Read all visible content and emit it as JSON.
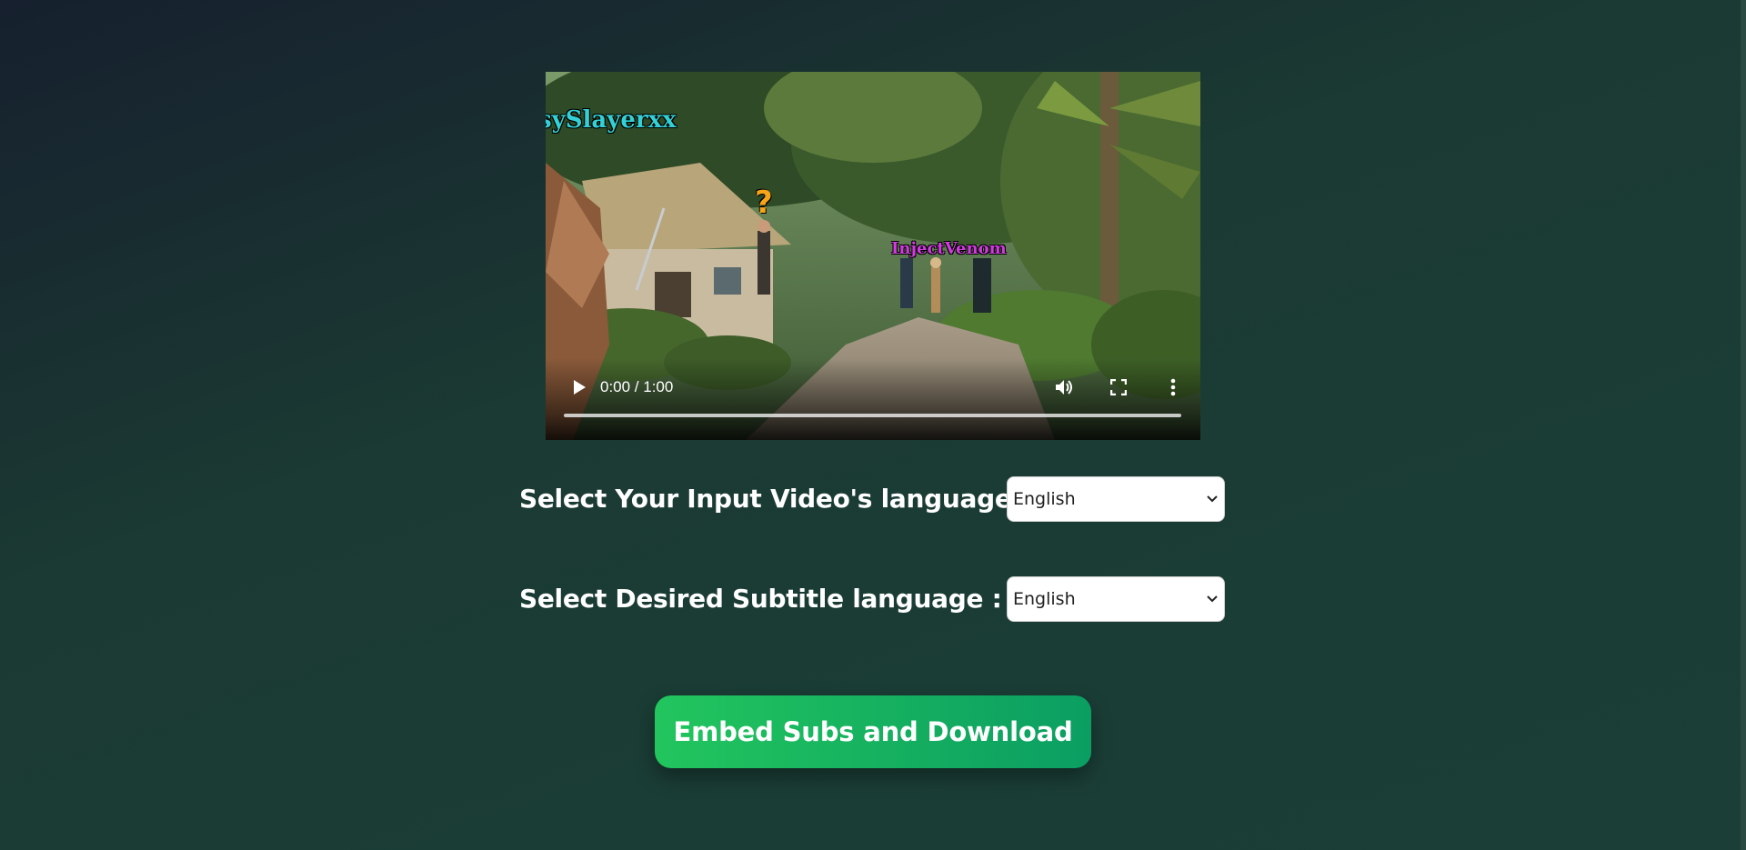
{
  "video": {
    "overlay_name_a": "sySlayerxx",
    "overlay_name_b": "InjectVenom",
    "overlay_question": "?",
    "time_display": "0:00 / 1:00",
    "progress_fraction": 0,
    "icons": {
      "play": "play-icon",
      "volume": "volume-icon",
      "fullscreen": "fullscreen-icon",
      "more": "more-vertical-icon"
    }
  },
  "form": {
    "input_language_label": "Select Your Input Video's language :",
    "input_language_value": "English",
    "subtitle_language_label": "Select Desired Subtitle language :",
    "subtitle_language_value": "English"
  },
  "actions": {
    "embed_label": "Embed Subs and Download"
  },
  "colors": {
    "button_start": "#22c55e",
    "button_end": "#0b9e62",
    "overlay_name_a": "#33d1d6",
    "overlay_name_b": "#d23be0"
  }
}
